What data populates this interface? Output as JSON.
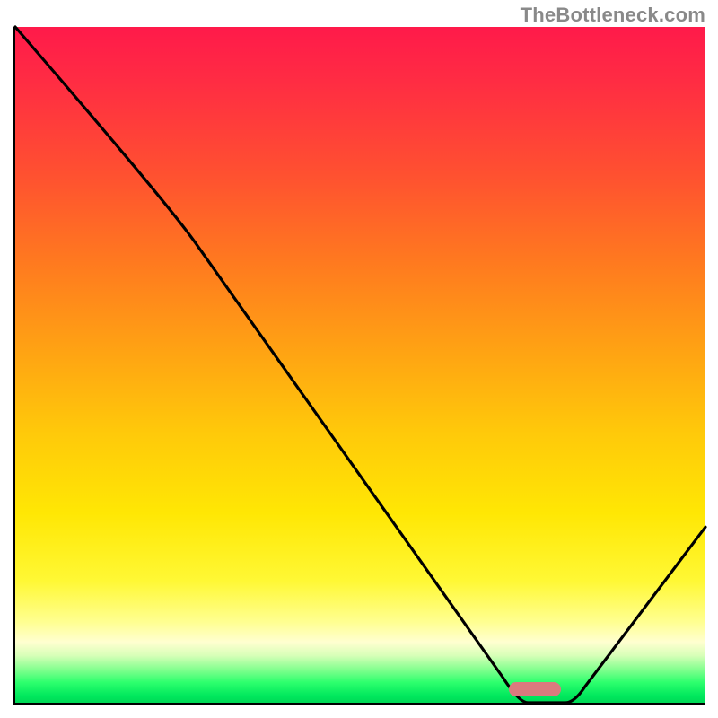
{
  "attribution": "TheBottleneck.com",
  "colors": {
    "gradient_top": "#ff1a4a",
    "gradient_bottom": "#00d856",
    "axis": "#000000",
    "curve": "#000000",
    "marker": "#db7a7e",
    "attribution": "#898989"
  },
  "chart_data": {
    "type": "line",
    "title": "",
    "xlabel": "",
    "ylabel": "",
    "xlim": [
      0,
      100
    ],
    "ylim": [
      0,
      100
    ],
    "x": [
      0,
      22,
      73,
      81,
      100
    ],
    "values": [
      100,
      74,
      0,
      0,
      26
    ],
    "optimum_range_x": [
      73,
      81
    ],
    "optimum_marker_y_pct": 1.6,
    "notes": "V-shaped bottleneck curve; valley is optimal (green), high values are worse (red). Approximate readings — no axis ticks present."
  },
  "marker": {
    "left_pct": 71.5,
    "bottom_pct": 0.9
  }
}
